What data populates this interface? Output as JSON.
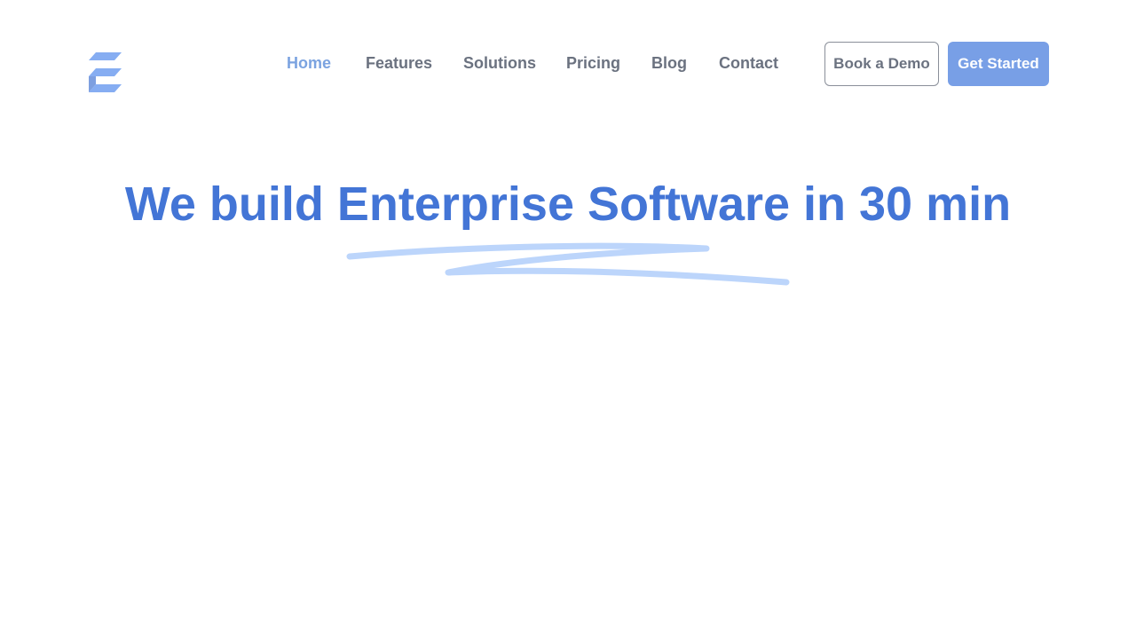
{
  "colors": {
    "brand": "#4375d6",
    "nav_active": "#7ba3e0",
    "nav_text": "#6b7280",
    "cta_bg": "#789fe6",
    "scribble": "#bcd5fb",
    "logo": "#86adf2"
  },
  "header": {
    "logo_icon": "stylized-e-logo",
    "nav": [
      {
        "label": "Home",
        "active": true
      },
      {
        "label": "Features",
        "active": false
      },
      {
        "label": "Solutions",
        "active": false
      },
      {
        "label": "Pricing",
        "active": false
      },
      {
        "label": "Blog",
        "active": false
      },
      {
        "label": "Contact",
        "active": false
      }
    ],
    "book_demo_label": "Book a Demo",
    "get_started_label": "Get Started"
  },
  "hero": {
    "title": "We build Enterprise Software in 30 min",
    "underline_icon": "scribble-underline"
  }
}
